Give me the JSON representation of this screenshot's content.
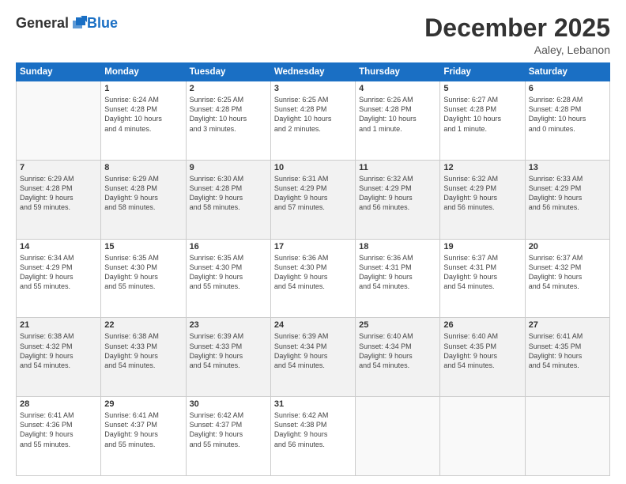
{
  "header": {
    "logo_general": "General",
    "logo_blue": "Blue",
    "month_title": "December 2025",
    "location": "Aaley, Lebanon"
  },
  "days_of_week": [
    "Sunday",
    "Monday",
    "Tuesday",
    "Wednesday",
    "Thursday",
    "Friday",
    "Saturday"
  ],
  "weeks": [
    [
      {
        "day": "",
        "info": ""
      },
      {
        "day": "1",
        "info": "Sunrise: 6:24 AM\nSunset: 4:28 PM\nDaylight: 10 hours\nand 4 minutes."
      },
      {
        "day": "2",
        "info": "Sunrise: 6:25 AM\nSunset: 4:28 PM\nDaylight: 10 hours\nand 3 minutes."
      },
      {
        "day": "3",
        "info": "Sunrise: 6:25 AM\nSunset: 4:28 PM\nDaylight: 10 hours\nand 2 minutes."
      },
      {
        "day": "4",
        "info": "Sunrise: 6:26 AM\nSunset: 4:28 PM\nDaylight: 10 hours\nand 1 minute."
      },
      {
        "day": "5",
        "info": "Sunrise: 6:27 AM\nSunset: 4:28 PM\nDaylight: 10 hours\nand 1 minute."
      },
      {
        "day": "6",
        "info": "Sunrise: 6:28 AM\nSunset: 4:28 PM\nDaylight: 10 hours\nand 0 minutes."
      }
    ],
    [
      {
        "day": "7",
        "info": "Sunrise: 6:29 AM\nSunset: 4:28 PM\nDaylight: 9 hours\nand 59 minutes."
      },
      {
        "day": "8",
        "info": "Sunrise: 6:29 AM\nSunset: 4:28 PM\nDaylight: 9 hours\nand 58 minutes."
      },
      {
        "day": "9",
        "info": "Sunrise: 6:30 AM\nSunset: 4:28 PM\nDaylight: 9 hours\nand 58 minutes."
      },
      {
        "day": "10",
        "info": "Sunrise: 6:31 AM\nSunset: 4:29 PM\nDaylight: 9 hours\nand 57 minutes."
      },
      {
        "day": "11",
        "info": "Sunrise: 6:32 AM\nSunset: 4:29 PM\nDaylight: 9 hours\nand 56 minutes."
      },
      {
        "day": "12",
        "info": "Sunrise: 6:32 AM\nSunset: 4:29 PM\nDaylight: 9 hours\nand 56 minutes."
      },
      {
        "day": "13",
        "info": "Sunrise: 6:33 AM\nSunset: 4:29 PM\nDaylight: 9 hours\nand 56 minutes."
      }
    ],
    [
      {
        "day": "14",
        "info": "Sunrise: 6:34 AM\nSunset: 4:29 PM\nDaylight: 9 hours\nand 55 minutes."
      },
      {
        "day": "15",
        "info": "Sunrise: 6:35 AM\nSunset: 4:30 PM\nDaylight: 9 hours\nand 55 minutes."
      },
      {
        "day": "16",
        "info": "Sunrise: 6:35 AM\nSunset: 4:30 PM\nDaylight: 9 hours\nand 55 minutes."
      },
      {
        "day": "17",
        "info": "Sunrise: 6:36 AM\nSunset: 4:30 PM\nDaylight: 9 hours\nand 54 minutes."
      },
      {
        "day": "18",
        "info": "Sunrise: 6:36 AM\nSunset: 4:31 PM\nDaylight: 9 hours\nand 54 minutes."
      },
      {
        "day": "19",
        "info": "Sunrise: 6:37 AM\nSunset: 4:31 PM\nDaylight: 9 hours\nand 54 minutes."
      },
      {
        "day": "20",
        "info": "Sunrise: 6:37 AM\nSunset: 4:32 PM\nDaylight: 9 hours\nand 54 minutes."
      }
    ],
    [
      {
        "day": "21",
        "info": "Sunrise: 6:38 AM\nSunset: 4:32 PM\nDaylight: 9 hours\nand 54 minutes."
      },
      {
        "day": "22",
        "info": "Sunrise: 6:38 AM\nSunset: 4:33 PM\nDaylight: 9 hours\nand 54 minutes."
      },
      {
        "day": "23",
        "info": "Sunrise: 6:39 AM\nSunset: 4:33 PM\nDaylight: 9 hours\nand 54 minutes."
      },
      {
        "day": "24",
        "info": "Sunrise: 6:39 AM\nSunset: 4:34 PM\nDaylight: 9 hours\nand 54 minutes."
      },
      {
        "day": "25",
        "info": "Sunrise: 6:40 AM\nSunset: 4:34 PM\nDaylight: 9 hours\nand 54 minutes."
      },
      {
        "day": "26",
        "info": "Sunrise: 6:40 AM\nSunset: 4:35 PM\nDaylight: 9 hours\nand 54 minutes."
      },
      {
        "day": "27",
        "info": "Sunrise: 6:41 AM\nSunset: 4:35 PM\nDaylight: 9 hours\nand 54 minutes."
      }
    ],
    [
      {
        "day": "28",
        "info": "Sunrise: 6:41 AM\nSunset: 4:36 PM\nDaylight: 9 hours\nand 55 minutes."
      },
      {
        "day": "29",
        "info": "Sunrise: 6:41 AM\nSunset: 4:37 PM\nDaylight: 9 hours\nand 55 minutes."
      },
      {
        "day": "30",
        "info": "Sunrise: 6:42 AM\nSunset: 4:37 PM\nDaylight: 9 hours\nand 55 minutes."
      },
      {
        "day": "31",
        "info": "Sunrise: 6:42 AM\nSunset: 4:38 PM\nDaylight: 9 hours\nand 56 minutes."
      },
      {
        "day": "",
        "info": ""
      },
      {
        "day": "",
        "info": ""
      },
      {
        "day": "",
        "info": ""
      }
    ]
  ]
}
